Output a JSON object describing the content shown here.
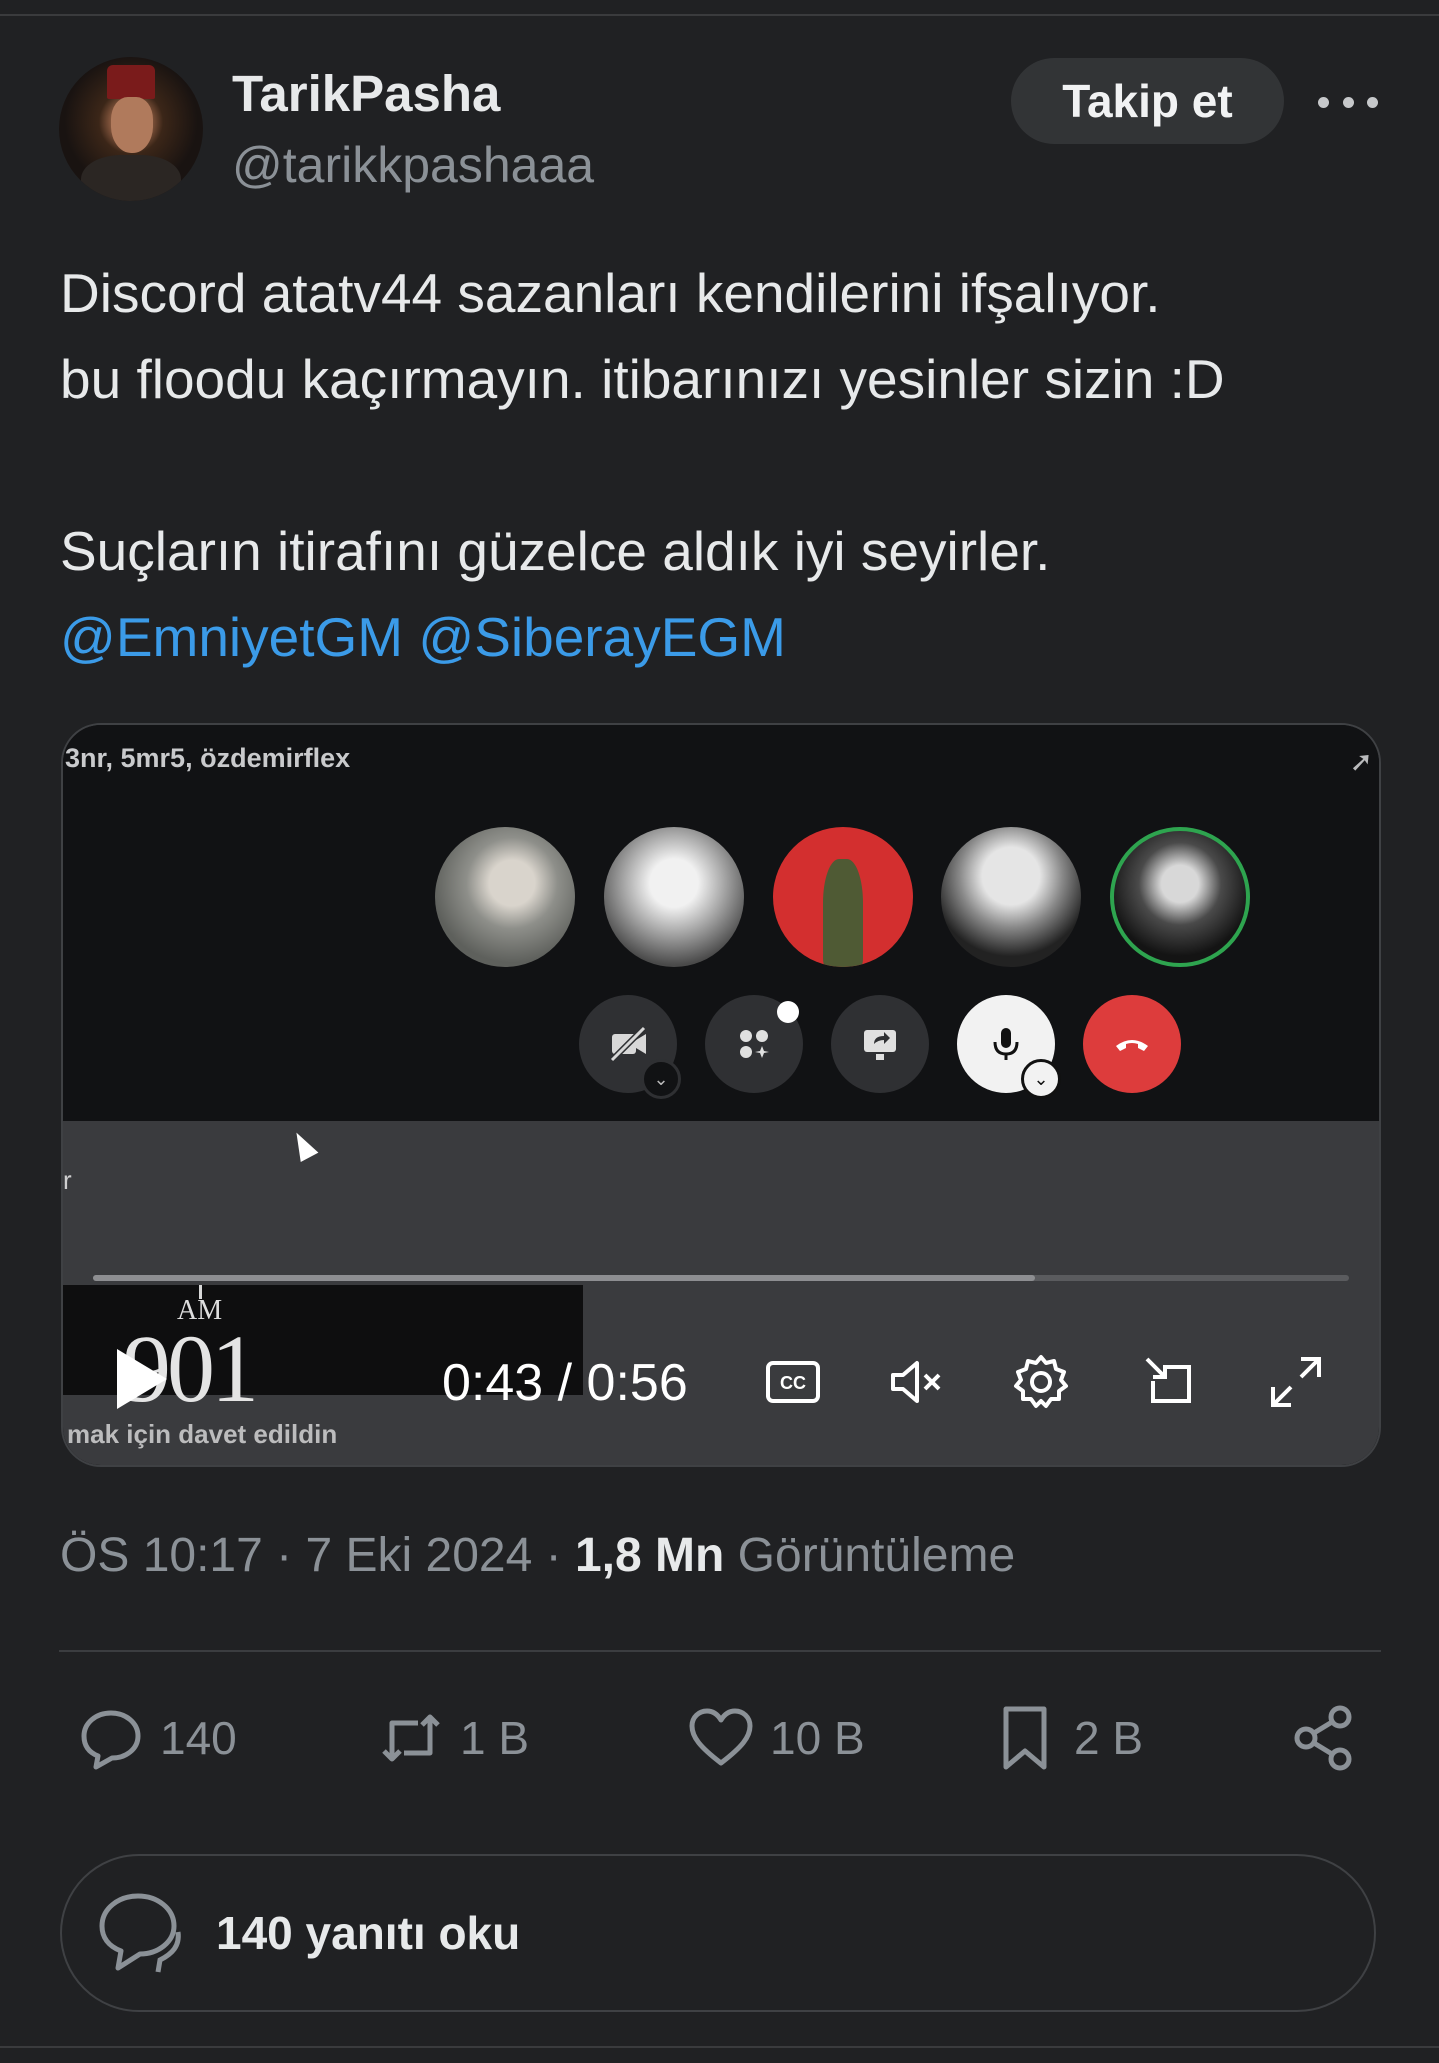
{
  "user": {
    "display_name": "TarikPasha",
    "handle": "@tarikkpashaaa",
    "follow_label": "Takip et"
  },
  "tweet": {
    "line1": "Discord atatv44 sazanları kendilerini ifşalıyor.",
    "line2": "bu floodu kaçırmayın. itibarınızı yesinler sizin :D",
    "line3": "Suçların itirafını güzelce aldık iyi seyirler.",
    "mention1": "@EmniyetGM",
    "mention2": "@SiberayEGM"
  },
  "video": {
    "call_participants_text": "3nr, 5mr5, özdemirflex",
    "side_text": "r",
    "clock_am": "AM",
    "clock_digits": "901",
    "invite_text": "mak için davet edildin",
    "time_label": "0:43 / 0:56",
    "progress": 0.75,
    "accent_end_call": "#dd3c3c",
    "speaking_ring": "#2ea44f"
  },
  "meta": {
    "time": "ÖS 10:17",
    "date": "7 Eki 2024",
    "views_count": "1,8 Mn",
    "views_label": "Görüntüleme"
  },
  "actions": {
    "replies": "140",
    "retweets": "1 B",
    "likes": "10 B",
    "bookmarks": "2 B"
  },
  "read_replies_label": "140 yanıtı oku",
  "colors": {
    "background": "#202123",
    "mention": "#3b9be8",
    "muted": "#8b9197"
  }
}
